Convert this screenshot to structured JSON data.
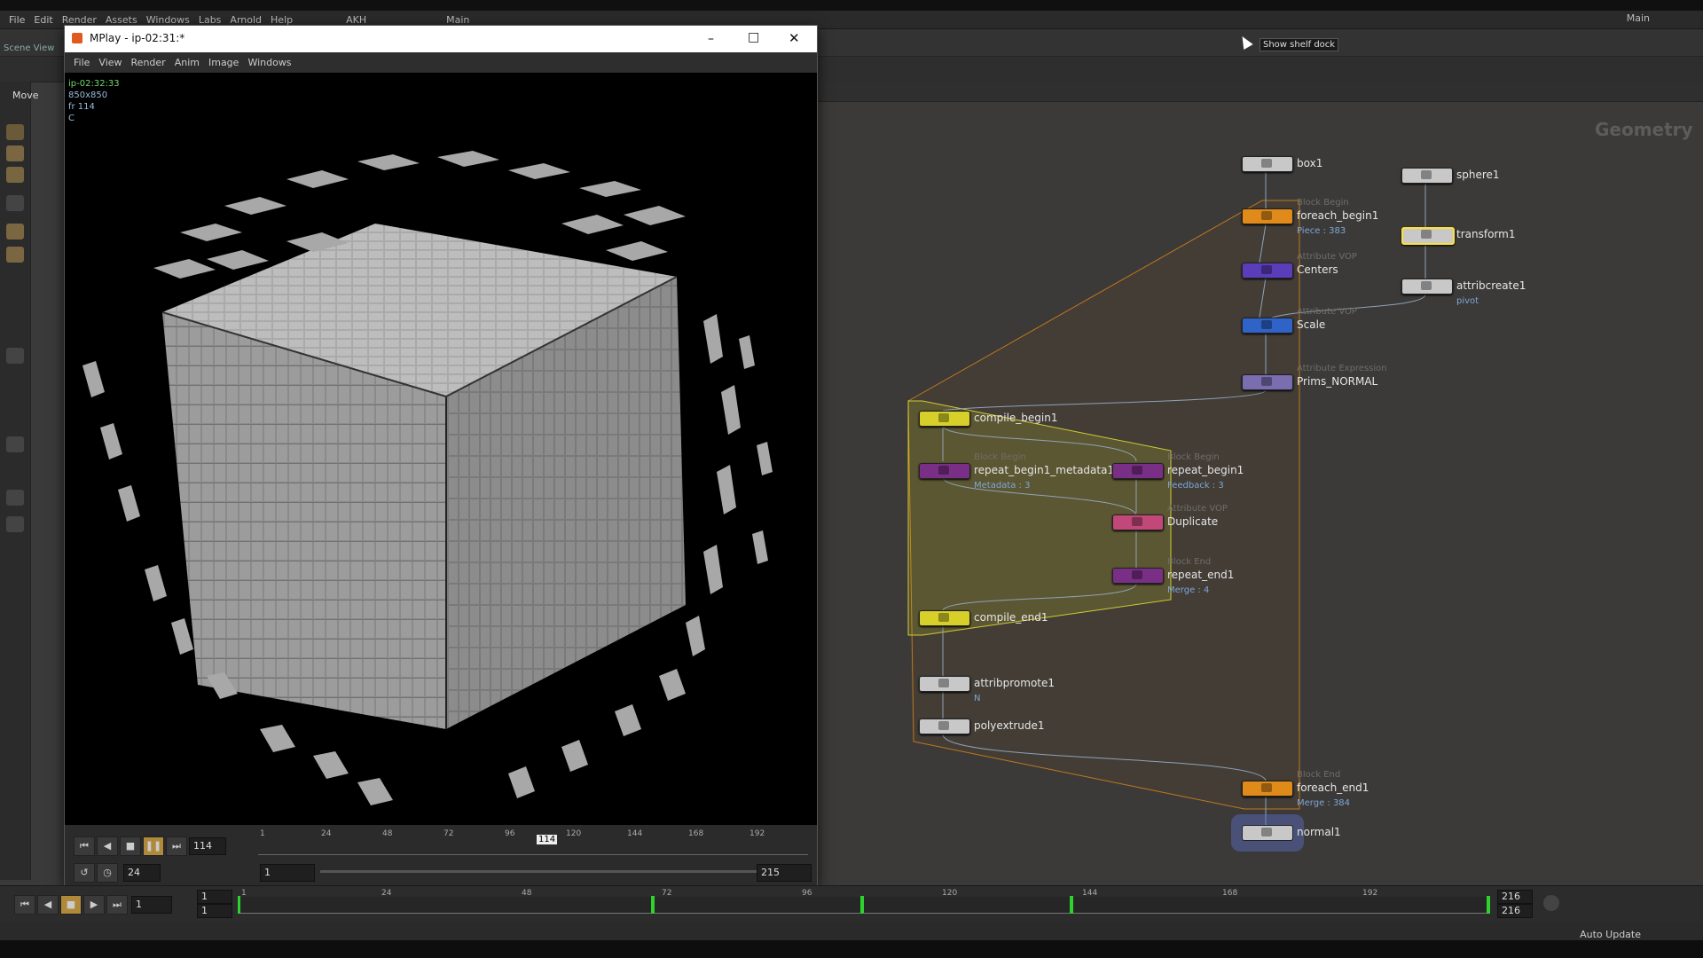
{
  "main_menu": [
    "File",
    "Edit",
    "Render",
    "Assets",
    "Windows",
    "Labs",
    "Arnold",
    "Help"
  ],
  "desk_name": "Main",
  "desk_tab": "AKH",
  "desk_tab2": "Main",
  "scene_view_label": "Scene View",
  "move_tool_label": "Move",
  "tooltip": "Show shelf dock",
  "mplay": {
    "title": "MPlay - ip-02:31:*",
    "menu": [
      "File",
      "View",
      "Render",
      "Anim",
      "Image",
      "Windows"
    ],
    "viewport_info": [
      "ip-02:32:33",
      "850x850",
      "fr 114",
      "C"
    ],
    "frame": "114",
    "fps": "24",
    "range_start": "1",
    "range_end": "215",
    "ruler_ticks": [
      "1",
      "24",
      "48",
      "72",
      "96",
      "120",
      "144",
      "168",
      "192"
    ],
    "current_marker": "114"
  },
  "network": {
    "context_label": "Geometry",
    "nodes": [
      {
        "name": "box1",
        "type": "",
        "info": "",
        "color": "#c8c8c8"
      },
      {
        "name": "sphere1",
        "type": "",
        "info": "",
        "color": "#c8c8c8"
      },
      {
        "name": "foreach_begin1",
        "type": "Block Begin",
        "info": "Piece : 383",
        "color": "#e08a1a"
      },
      {
        "name": "transform1",
        "type": "",
        "info": "",
        "color": "#c8c8c8"
      },
      {
        "name": "Centers",
        "type": "Attribute VOP",
        "info": "",
        "color": "#5a3db8"
      },
      {
        "name": "attribcreate1",
        "type": "",
        "info": "pivot",
        "color": "#c8c8c8"
      },
      {
        "name": "Scale",
        "type": "Attribute VOP",
        "info": "",
        "color": "#2f63c8"
      },
      {
        "name": "Prims_NORMAL",
        "type": "Attribute Expression",
        "info": "",
        "color": "#7a6eb0"
      },
      {
        "name": "compile_begin1",
        "type": "",
        "info": "",
        "color": "#d7d02a"
      },
      {
        "name": "repeat_begin1_metadata1",
        "type": "Block Begin",
        "info": "Metadata : 3",
        "color": "#7a2f86"
      },
      {
        "name": "repeat_begin1",
        "type": "Block Begin",
        "info": "Feedback : 3",
        "color": "#7a2f86"
      },
      {
        "name": "Duplicate",
        "type": "Attribute VOP",
        "info": "",
        "color": "#c2487a"
      },
      {
        "name": "repeat_end1",
        "type": "Block End",
        "info": "Merge : 4",
        "color": "#7a2f86"
      },
      {
        "name": "compile_end1",
        "type": "",
        "info": "",
        "color": "#d7d02a"
      },
      {
        "name": "attribpromote1",
        "type": "",
        "info": "N",
        "color": "#c8c8c8"
      },
      {
        "name": "polyextrude1",
        "type": "",
        "info": "",
        "color": "#c8c8c8"
      },
      {
        "name": "foreach_end1",
        "type": "Block End",
        "info": "Merge : 384",
        "color": "#e08a1a"
      },
      {
        "name": "normal1",
        "type": "",
        "info": "",
        "color": "#c8c8c8"
      }
    ]
  },
  "timeline": {
    "ticks": [
      "1",
      "24",
      "48",
      "72",
      "96",
      "120",
      "144",
      "168",
      "192"
    ],
    "frame": "1",
    "start": "1",
    "start2": "1",
    "end": "216",
    "end2": "216",
    "auto_update": "Auto Update"
  }
}
